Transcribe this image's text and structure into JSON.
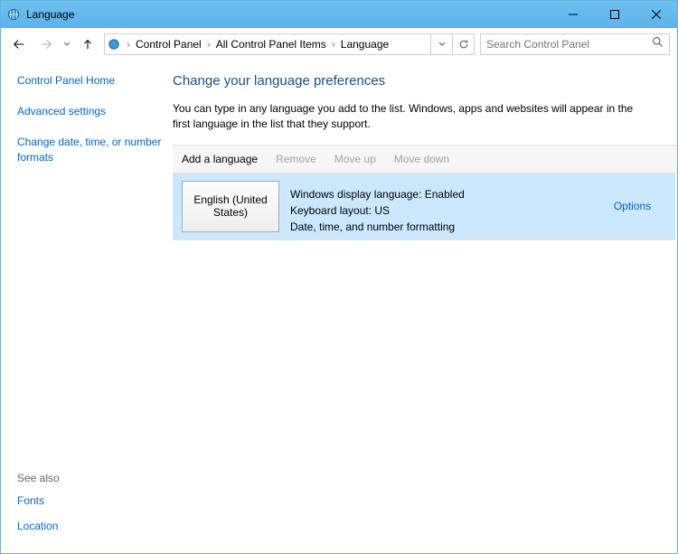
{
  "window": {
    "title": "Language"
  },
  "breadcrumbs": {
    "root": "Control Panel",
    "mid": "All Control Panel Items",
    "leaf": "Language"
  },
  "search": {
    "placeholder": "Search Control Panel"
  },
  "sidebar": {
    "home": "Control Panel Home",
    "advanced": "Advanced settings",
    "dateformats": "Change date, time, or number formats",
    "seealso": "See also",
    "fonts": "Fonts",
    "location": "Location"
  },
  "main": {
    "heading": "Change your language preferences",
    "description": "You can type in any language you add to the list. Windows, apps and websites will appear in the first language in the list that they support."
  },
  "toolbar": {
    "add": "Add a language",
    "remove": "Remove",
    "moveup": "Move up",
    "movedown": "Move down"
  },
  "language_item": {
    "name": "English (United States)",
    "detail1": "Windows display language: Enabled",
    "detail2": "Keyboard layout: US",
    "detail3": "Date, time, and number formatting",
    "options": "Options"
  }
}
